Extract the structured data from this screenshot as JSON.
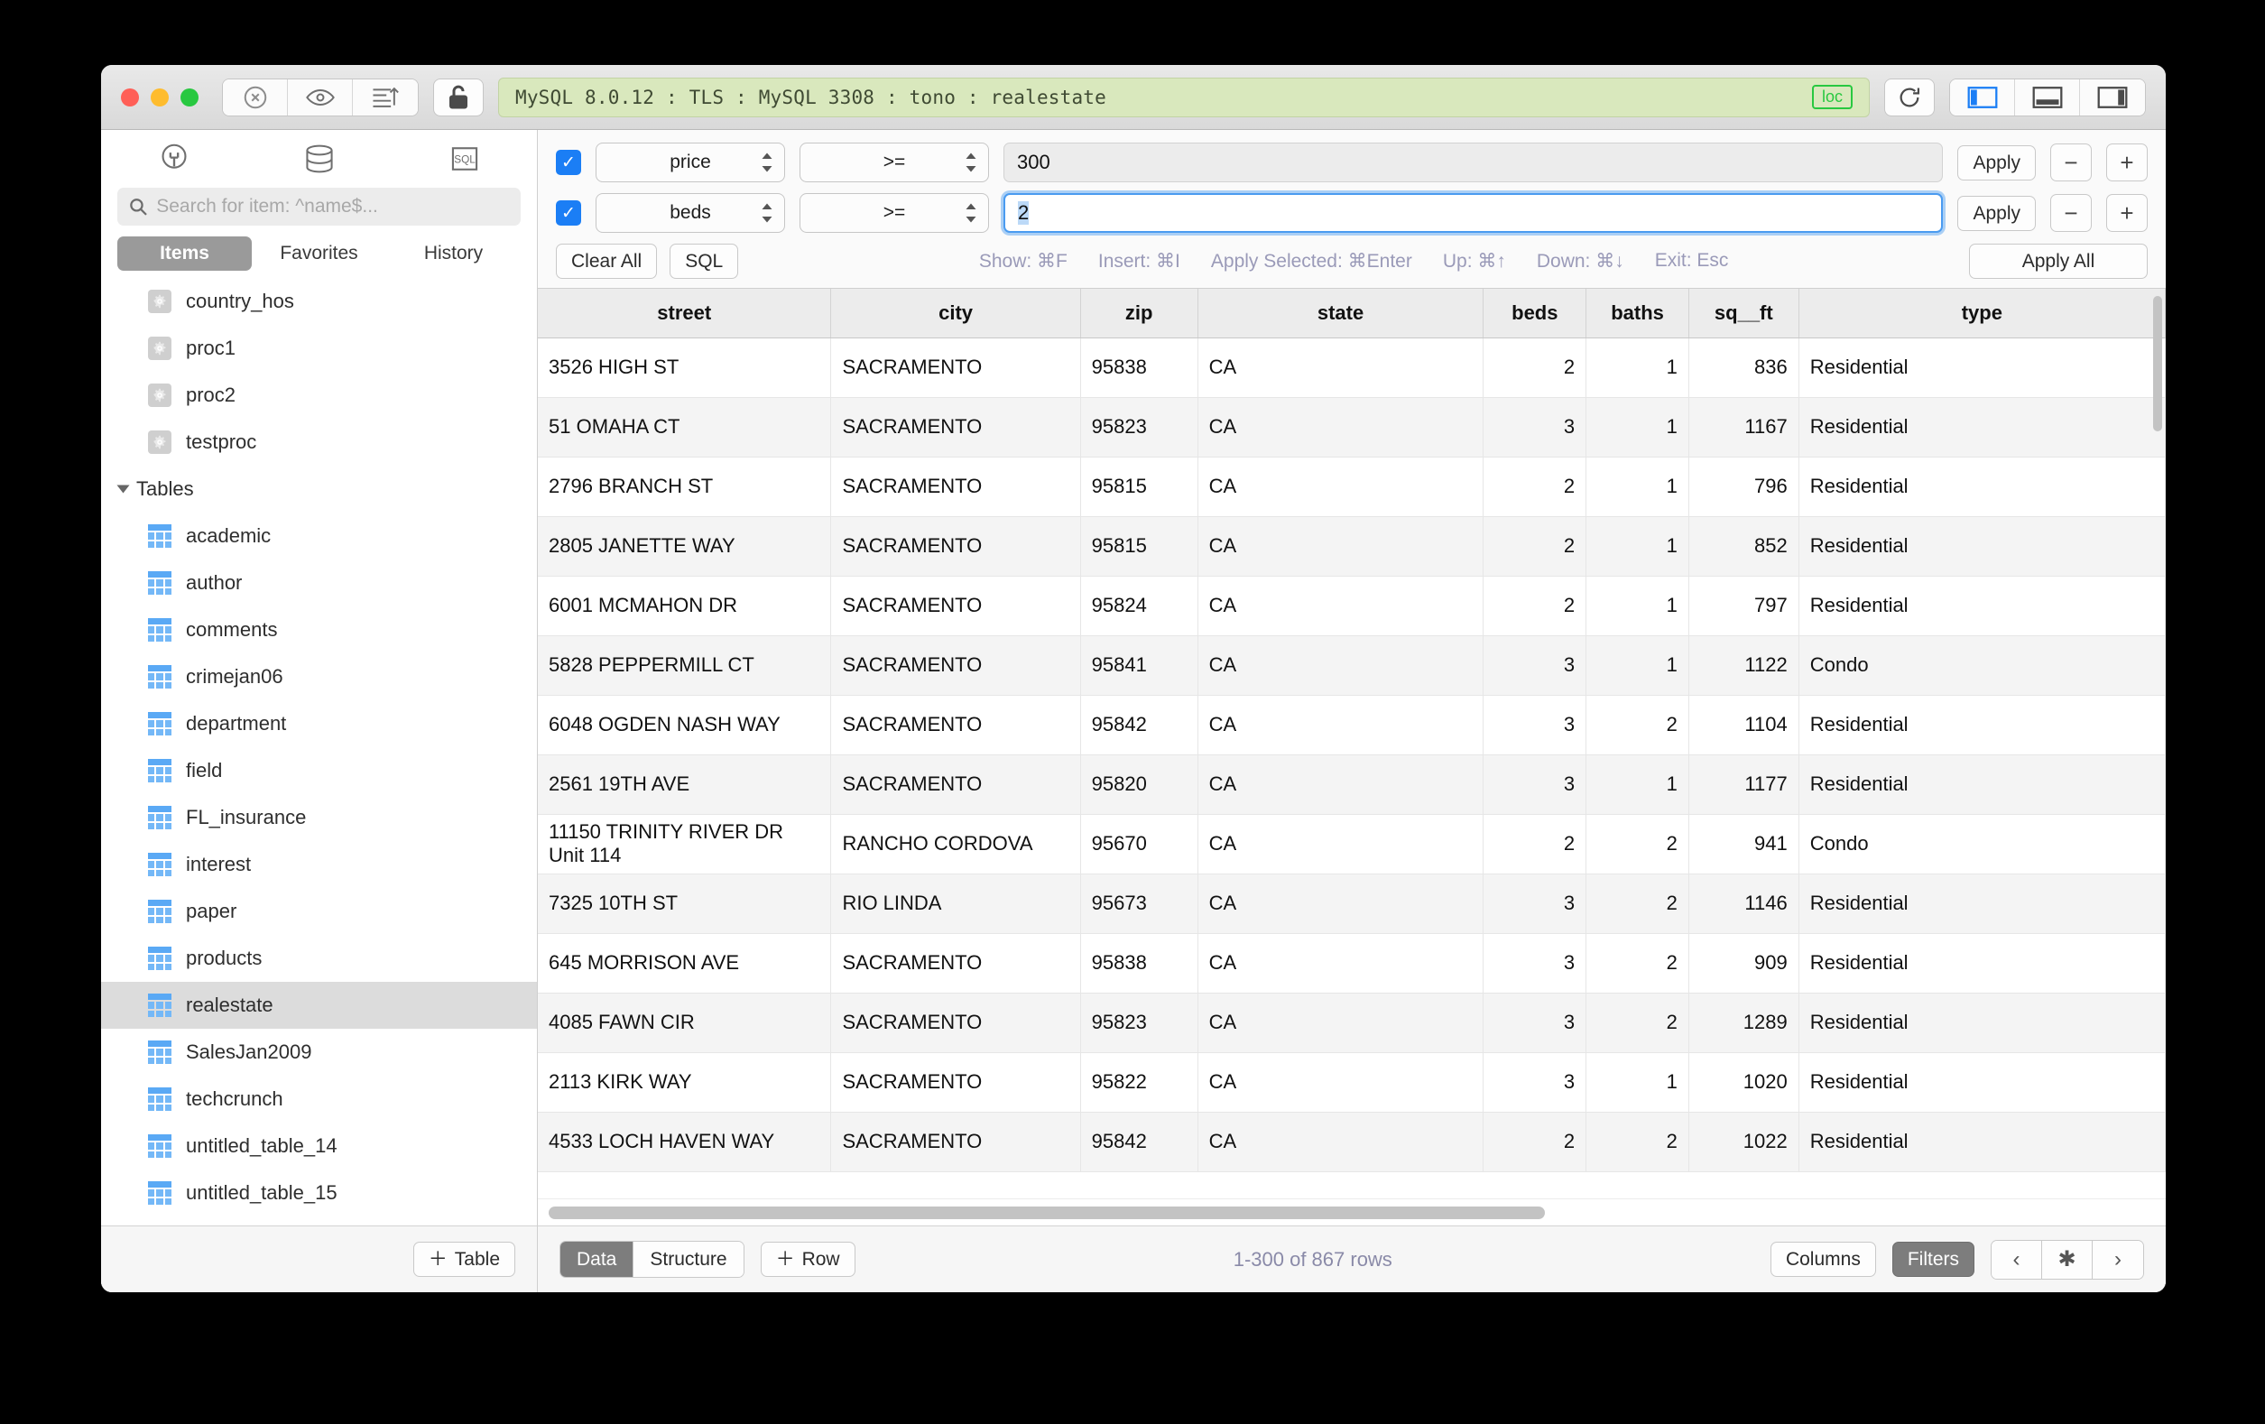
{
  "titlebar": {
    "connection": "MySQL 8.0.12 : TLS : MySQL 3308 : tono : realestate",
    "loc_badge": "loc"
  },
  "sidebar": {
    "search_placeholder": "Search for item: ^name$...",
    "tabs": [
      {
        "label": "Items",
        "active": true
      },
      {
        "label": "Favorites",
        "active": false
      },
      {
        "label": "History",
        "active": false
      }
    ],
    "procedures": [
      {
        "label": "country_hos",
        "icon": "gear-icon"
      },
      {
        "label": "proc1",
        "icon": "gear-icon"
      },
      {
        "label": "proc2",
        "icon": "gear-icon"
      },
      {
        "label": "testproc",
        "icon": "gear-icon"
      }
    ],
    "group_label": "Tables",
    "tables": [
      {
        "label": "academic",
        "selected": false
      },
      {
        "label": "author",
        "selected": false
      },
      {
        "label": "comments",
        "selected": false
      },
      {
        "label": "crimejan06",
        "selected": false
      },
      {
        "label": "department",
        "selected": false
      },
      {
        "label": "field",
        "selected": false
      },
      {
        "label": "FL_insurance",
        "selected": false
      },
      {
        "label": "interest",
        "selected": false
      },
      {
        "label": "paper",
        "selected": false
      },
      {
        "label": "products",
        "selected": false
      },
      {
        "label": "realestate",
        "selected": true
      },
      {
        "label": "SalesJan2009",
        "selected": false
      },
      {
        "label": "techcrunch",
        "selected": false
      },
      {
        "label": "untitled_table_14",
        "selected": false
      },
      {
        "label": "untitled_table_15",
        "selected": false
      }
    ],
    "add_table_label": "Table"
  },
  "filters": {
    "rows": [
      {
        "checked": true,
        "column": "price",
        "operator": ">=",
        "value": "300",
        "apply_label": "Apply",
        "focused": false
      },
      {
        "checked": true,
        "column": "beds",
        "operator": ">=",
        "value": "2",
        "apply_label": "Apply",
        "focused": true
      }
    ],
    "clear_all_label": "Clear All",
    "sql_label": "SQL",
    "apply_all_label": "Apply All",
    "hints": [
      "Show: ⌘F",
      "Insert: ⌘I",
      "Apply Selected: ⌘Enter",
      "Up: ⌘↑",
      "Down: ⌘↓",
      "Exit: Esc"
    ]
  },
  "table": {
    "columns": [
      "street",
      "city",
      "zip",
      "state",
      "beds",
      "baths",
      "sq__ft",
      "type"
    ],
    "rows": [
      {
        "street": "3526 HIGH ST",
        "city": "SACRAMENTO",
        "zip": "95838",
        "state": "CA",
        "beds": "2",
        "baths": "1",
        "sq__ft": "836",
        "type": "Residential"
      },
      {
        "street": "51 OMAHA CT",
        "city": "SACRAMENTO",
        "zip": "95823",
        "state": "CA",
        "beds": "3",
        "baths": "1",
        "sq__ft": "1167",
        "type": "Residential"
      },
      {
        "street": "2796 BRANCH ST",
        "city": "SACRAMENTO",
        "zip": "95815",
        "state": "CA",
        "beds": "2",
        "baths": "1",
        "sq__ft": "796",
        "type": "Residential"
      },
      {
        "street": "2805 JANETTE WAY",
        "city": "SACRAMENTO",
        "zip": "95815",
        "state": "CA",
        "beds": "2",
        "baths": "1",
        "sq__ft": "852",
        "type": "Residential"
      },
      {
        "street": "6001 MCMAHON DR",
        "city": "SACRAMENTO",
        "zip": "95824",
        "state": "CA",
        "beds": "2",
        "baths": "1",
        "sq__ft": "797",
        "type": "Residential"
      },
      {
        "street": "5828 PEPPERMILL CT",
        "city": "SACRAMENTO",
        "zip": "95841",
        "state": "CA",
        "beds": "3",
        "baths": "1",
        "sq__ft": "1122",
        "type": "Condo"
      },
      {
        "street": "6048 OGDEN NASH WAY",
        "city": "SACRAMENTO",
        "zip": "95842",
        "state": "CA",
        "beds": "3",
        "baths": "2",
        "sq__ft": "1104",
        "type": "Residential"
      },
      {
        "street": "2561 19TH AVE",
        "city": "SACRAMENTO",
        "zip": "95820",
        "state": "CA",
        "beds": "3",
        "baths": "1",
        "sq__ft": "1177",
        "type": "Residential"
      },
      {
        "street": "11150 TRINITY RIVER DR Unit 114",
        "city": "RANCHO CORDOVA",
        "zip": "95670",
        "state": "CA",
        "beds": "2",
        "baths": "2",
        "sq__ft": "941",
        "type": "Condo"
      },
      {
        "street": "7325 10TH ST",
        "city": "RIO LINDA",
        "zip": "95673",
        "state": "CA",
        "beds": "3",
        "baths": "2",
        "sq__ft": "1146",
        "type": "Residential"
      },
      {
        "street": "645 MORRISON AVE",
        "city": "SACRAMENTO",
        "zip": "95838",
        "state": "CA",
        "beds": "3",
        "baths": "2",
        "sq__ft": "909",
        "type": "Residential"
      },
      {
        "street": "4085 FAWN CIR",
        "city": "SACRAMENTO",
        "zip": "95823",
        "state": "CA",
        "beds": "3",
        "baths": "2",
        "sq__ft": "1289",
        "type": "Residential"
      },
      {
        "street": "2113 KIRK WAY",
        "city": "SACRAMENTO",
        "zip": "95822",
        "state": "CA",
        "beds": "3",
        "baths": "1",
        "sq__ft": "1020",
        "type": "Residential"
      },
      {
        "street": "4533 LOCH HAVEN WAY",
        "city": "SACRAMENTO",
        "zip": "95842",
        "state": "CA",
        "beds": "2",
        "baths": "2",
        "sq__ft": "1022",
        "type": "Residential"
      }
    ]
  },
  "bottombar": {
    "data_label": "Data",
    "structure_label": "Structure",
    "add_row_label": "Row",
    "status": "1-300 of 867 rows",
    "columns_label": "Columns",
    "filters_label": "Filters"
  }
}
